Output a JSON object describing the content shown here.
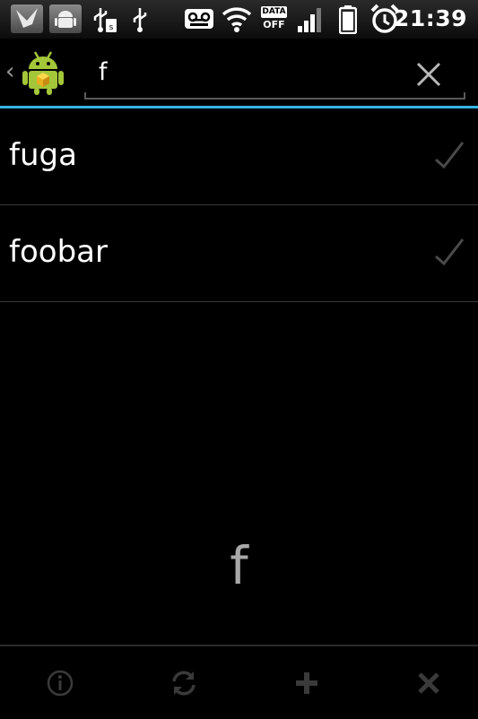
{
  "status_bar": {
    "time": "21:39",
    "data_badge_top": "DATA",
    "data_badge_bottom": "OFF",
    "icons": [
      "notification-bird-icon",
      "android-notification-icon",
      "usb-sd-icon",
      "usb-icon",
      "voicemail-icon",
      "wifi-icon",
      "signal-icon",
      "battery-icon",
      "alarm-icon"
    ]
  },
  "search": {
    "query": "f",
    "clear_icon": "close-icon",
    "back_icon": "chevron-left-icon",
    "app_icon": "android-app-icon",
    "accent_color": "#33b5e5"
  },
  "list": {
    "items": [
      {
        "label": "fuga",
        "checked": true
      },
      {
        "label": "foobar",
        "checked": true
      }
    ]
  },
  "fast_scroll_letter": "f",
  "bottom_bar": {
    "actions": [
      {
        "name": "info",
        "icon": "info-icon"
      },
      {
        "name": "sync",
        "icon": "sync-icon"
      },
      {
        "name": "add",
        "icon": "plus-icon"
      },
      {
        "name": "delete",
        "icon": "close-icon"
      }
    ]
  }
}
